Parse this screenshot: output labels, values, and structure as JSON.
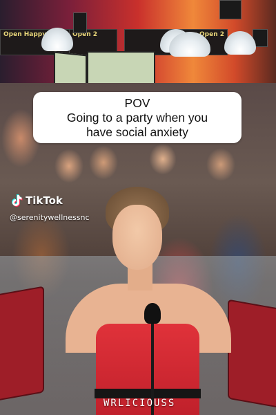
{
  "caption": {
    "line1": "POV",
    "line2": "Going to a party when you",
    "line3": "have social anxiety"
  },
  "tiktok": {
    "brand": "TikTok",
    "handle": "@serenitywellnessnc",
    "icon": "tiktok-logo-icon"
  },
  "background": {
    "sign_left": "Open Happy",
    "sign_center": "Open 2",
    "sign_right": "Doors Open 2"
  },
  "watermark": "WRLICIOUSS"
}
